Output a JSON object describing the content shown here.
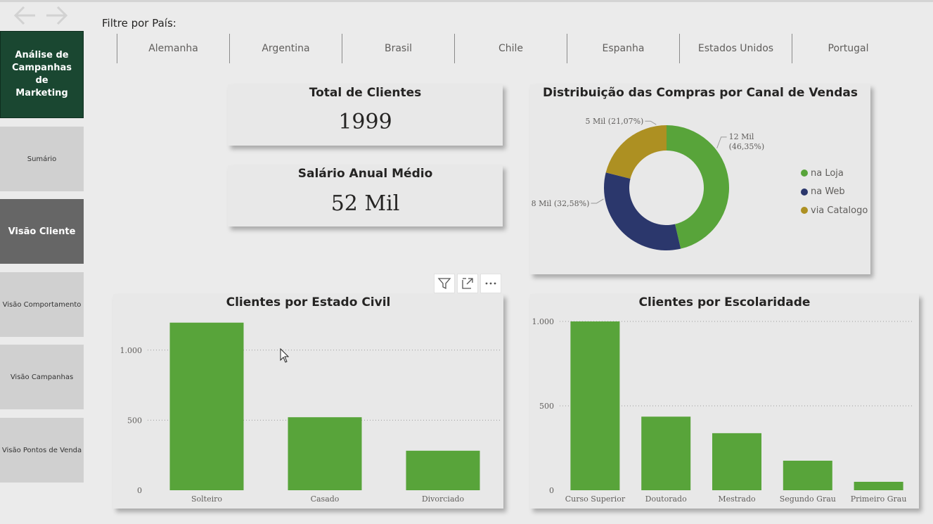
{
  "nav": {
    "back_icon": "arrow-left-icon",
    "forward_icon": "arrow-right-icon"
  },
  "sidebar": {
    "title": "Análise de Campanhas de Marketing",
    "items": [
      {
        "label": "Sumário",
        "active": false
      },
      {
        "label": "Visão Cliente",
        "active": true
      },
      {
        "label": "Visão Comportamento",
        "active": false
      },
      {
        "label": "Visão Campanhas",
        "active": false
      },
      {
        "label": "Visão Pontos de Venda",
        "active": false
      }
    ]
  },
  "filter": {
    "label": "Filtre por País:",
    "countries": [
      "Alemanha",
      "Argentina",
      "Brasil",
      "Chile",
      "Espanha",
      "Estados Unidos",
      "Portugal"
    ]
  },
  "kpis": {
    "total_clientes": {
      "title": "Total de Clientes",
      "value": "1999"
    },
    "salario": {
      "title": "Salário Anual Médio",
      "value": "52 Mil"
    }
  },
  "visual_header": {
    "icons": [
      "filter-icon",
      "focus-mode-icon",
      "more-options-icon"
    ]
  },
  "colors": {
    "loja": "#58a43a",
    "web": "#2b376c",
    "catalogo": "#ad9022",
    "bar": "#58a43a",
    "title_bg": "#1a4731"
  },
  "chart_data": [
    {
      "type": "pie",
      "title": "Distribuição das Compras por Canal de Vendas",
      "donut": true,
      "categories": [
        "na Loja",
        "na Web",
        "via Catalogo"
      ],
      "values": [
        46.35,
        32.58,
        21.07
      ],
      "data_labels": [
        "12 Mil\n(46,35%)",
        "8 Mil (32,58%)",
        "5 Mil (21,07%)"
      ],
      "legend": "right"
    },
    {
      "type": "bar",
      "title": "Clientes por Estado Civil",
      "categories": [
        "Solteiro",
        "Casado",
        "Divorciado"
      ],
      "values": [
        1196,
        521,
        282
      ],
      "ylim": [
        0,
        1300
      ],
      "yticks": [
        0,
        500,
        1000
      ],
      "ytick_labels": [
        "0",
        "500",
        "1.000"
      ],
      "grid": true
    },
    {
      "type": "bar",
      "title": "Clientes por Escolaridade",
      "categories": [
        "Curso Superior",
        "Doutorado",
        "Mestrado",
        "Segundo Grau",
        "Primeiro Grau"
      ],
      "values": [
        1000,
        436,
        338,
        175,
        50
      ],
      "ylim": [
        0,
        1000
      ],
      "yticks": [
        0,
        500,
        1000
      ],
      "ytick_labels": [
        "0",
        "500",
        "1.000"
      ],
      "grid": true
    }
  ]
}
